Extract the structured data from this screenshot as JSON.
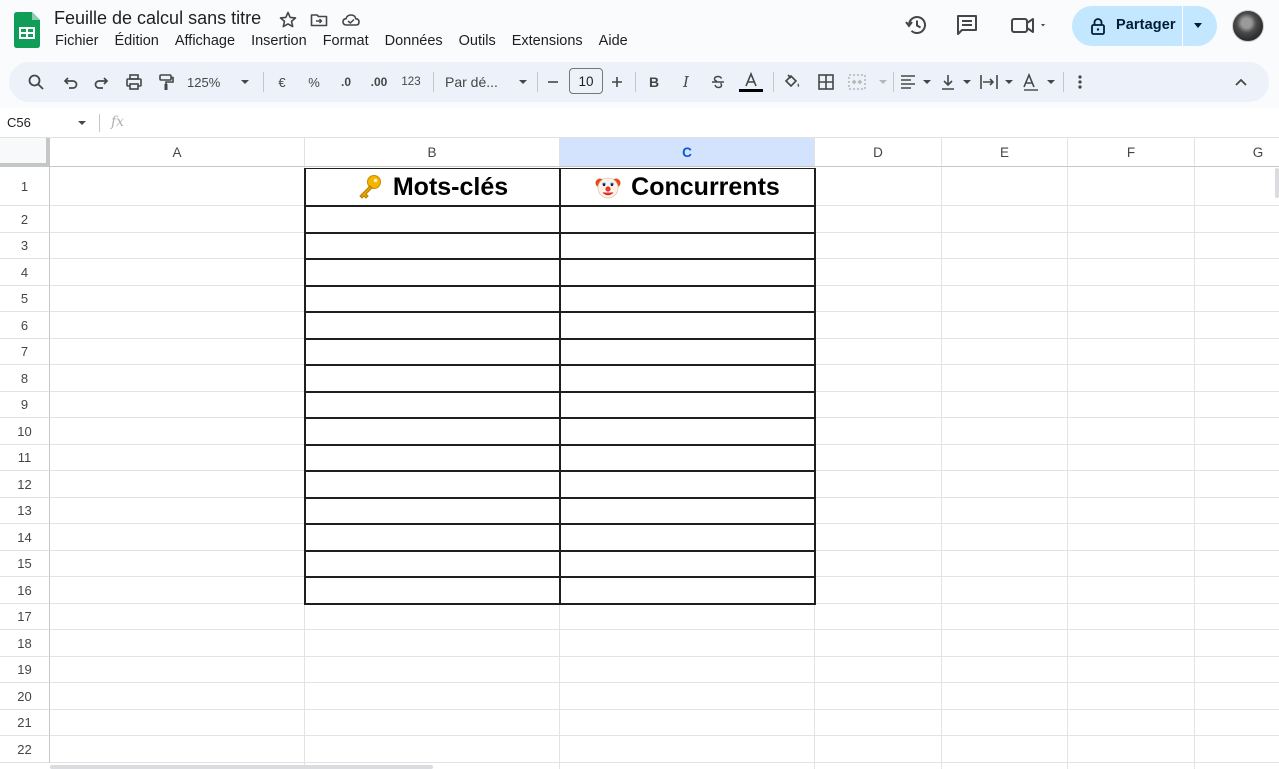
{
  "document": {
    "title": "Feuille de calcul sans titre"
  },
  "menu": [
    "Fichier",
    "Édition",
    "Affichage",
    "Insertion",
    "Format",
    "Données",
    "Outils",
    "Extensions",
    "Aide"
  ],
  "share": {
    "label": "Partager"
  },
  "toolbar": {
    "zoom": "125%",
    "currency": "€",
    "percent": "%",
    "decrease_decimals": ".0",
    "increase_decimals": ".00",
    "number_format": "123",
    "font_family": "Par dé...",
    "font_size": "10",
    "bold": "B",
    "italic": "I"
  },
  "formula_bar": {
    "cell_ref": "C56",
    "fx": "fx"
  },
  "columns": [
    {
      "label": "A",
      "selected": false
    },
    {
      "label": "B",
      "selected": false
    },
    {
      "label": "C",
      "selected": true
    },
    {
      "label": "D",
      "selected": false
    },
    {
      "label": "E",
      "selected": false
    },
    {
      "label": "F",
      "selected": false
    },
    {
      "label": "G",
      "selected": false
    }
  ],
  "rows": [
    "1",
    "2",
    "3",
    "4",
    "5",
    "6",
    "7",
    "8",
    "9",
    "10",
    "11",
    "12",
    "13",
    "14",
    "15",
    "16",
    "17",
    "18",
    "19",
    "20",
    "21",
    "22"
  ],
  "cells": {
    "B1": {
      "icon": "key-emoji-icon",
      "text": "Mots-clés"
    },
    "C1": {
      "icon": "clown-face-emoji-icon",
      "text": "Concurrents"
    }
  },
  "colors": {
    "sheets_green": "#0f9d58",
    "share_button": "#c2e7ff",
    "selected_header": "#d3e3fd",
    "toolbar_bg": "#edf2fa"
  }
}
